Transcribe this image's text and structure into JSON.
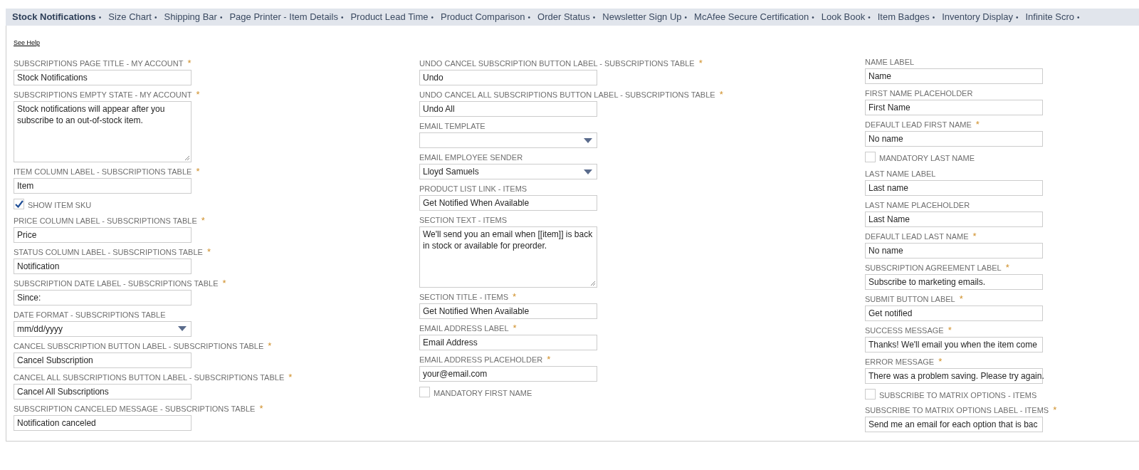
{
  "tabs": [
    {
      "label": "Stock Notifications",
      "selected": true
    },
    {
      "label": "Size Chart",
      "selected": false
    },
    {
      "label": "Shipping Bar",
      "selected": false
    },
    {
      "label": "Page Printer - Item Details",
      "selected": false
    },
    {
      "label": "Product Lead Time",
      "selected": false
    },
    {
      "label": "Product Comparison",
      "selected": false
    },
    {
      "label": "Order Status",
      "selected": false
    },
    {
      "label": "Newsletter Sign Up",
      "selected": false
    },
    {
      "label": "McAfee Secure Certification",
      "selected": false
    },
    {
      "label": "Look Book",
      "selected": false
    },
    {
      "label": "Item Badges",
      "selected": false
    },
    {
      "label": "Inventory Display",
      "selected": false
    },
    {
      "label": "Infinite Scro",
      "selected": false
    }
  ],
  "tab_separator": "•",
  "help_link": "See Help",
  "columns": [
    [
      {
        "kind": "text",
        "label": "SUBSCRIPTIONS PAGE TITLE - MY ACCOUNT",
        "required": true,
        "value": "Stock Notifications"
      },
      {
        "kind": "textarea",
        "label": "SUBSCRIPTIONS EMPTY STATE - MY ACCOUNT",
        "required": true,
        "value": "Stock notifications will appear after you subscribe to an out-of-stock item."
      },
      {
        "kind": "text",
        "label": "ITEM COLUMN LABEL - SUBSCRIPTIONS TABLE",
        "required": true,
        "value": "Item"
      },
      {
        "kind": "checkbox",
        "label": "SHOW ITEM SKU",
        "checked": true
      },
      {
        "kind": "text",
        "label": "PRICE COLUMN LABEL - SUBSCRIPTIONS TABLE",
        "required": true,
        "value": "Price"
      },
      {
        "kind": "text",
        "label": "STATUS COLUMN LABEL - SUBSCRIPTIONS TABLE",
        "required": true,
        "value": "Notification"
      },
      {
        "kind": "text",
        "label": "SUBSCRIPTION DATE LABEL - SUBSCRIPTIONS TABLE",
        "required": true,
        "value": "Since:"
      },
      {
        "kind": "select",
        "label": "DATE FORMAT - SUBSCRIPTIONS TABLE",
        "required": false,
        "value": "mm/dd/yyyy"
      },
      {
        "kind": "text",
        "label": "CANCEL SUBSCRIPTION BUTTON LABEL - SUBSCRIPTIONS TABLE",
        "required": true,
        "value": "Cancel Subscription"
      },
      {
        "kind": "text",
        "label": "CANCEL ALL SUBSCRIPTIONS BUTTON LABEL - SUBSCRIPTIONS TABLE",
        "required": true,
        "value": "Cancel All Subscriptions"
      },
      {
        "kind": "text",
        "label": "SUBSCRIPTION CANCELED MESSAGE - SUBSCRIPTIONS TABLE",
        "required": true,
        "value": "Notification canceled"
      }
    ],
    [
      {
        "kind": "text",
        "label": "UNDO CANCEL SUBSCRIPTION BUTTON LABEL - SUBSCRIPTIONS TABLE",
        "required": true,
        "value": "Undo"
      },
      {
        "kind": "text",
        "label": "UNDO CANCEL ALL SUBSCRIPTIONS BUTTON LABEL - SUBSCRIPTIONS TABLE",
        "required": true,
        "value": "Undo All"
      },
      {
        "kind": "select",
        "label": "EMAIL TEMPLATE",
        "required": false
      },
      {
        "kind": "select",
        "label": "EMAIL EMPLOYEE SENDER",
        "required": false,
        "value": "Lloyd Samuels"
      },
      {
        "kind": "text",
        "label": "PRODUCT LIST LINK - ITEMS",
        "required": false,
        "value": "Get Notified When Available"
      },
      {
        "kind": "textarea",
        "label": "SECTION TEXT - ITEMS",
        "required": false,
        "value": "We'll send you an email when [[item]] is back in stock or available for preorder."
      },
      {
        "kind": "text",
        "label": "SECTION TITLE - ITEMS",
        "required": true,
        "value": "Get Notified When Available"
      },
      {
        "kind": "text",
        "label": "EMAIL ADDRESS LABEL",
        "required": true,
        "value": "Email Address"
      },
      {
        "kind": "text",
        "label": "EMAIL ADDRESS PLACEHOLDER",
        "required": true,
        "value": "your@email.com"
      },
      {
        "kind": "checkbox",
        "label": "MANDATORY FIRST NAME",
        "checked": false
      }
    ],
    [
      {
        "kind": "text",
        "label": "NAME LABEL",
        "required": false,
        "value": "Name"
      },
      {
        "kind": "text",
        "label": "FIRST NAME PLACEHOLDER",
        "required": false,
        "value": "First Name"
      },
      {
        "kind": "text",
        "label": "DEFAULT LEAD FIRST NAME",
        "required": true,
        "value": "No name"
      },
      {
        "kind": "checkbox",
        "label": "MANDATORY LAST NAME",
        "checked": false
      },
      {
        "kind": "text",
        "label": "LAST NAME LABEL",
        "required": false,
        "value": "Last name"
      },
      {
        "kind": "text",
        "label": "LAST NAME PLACEHOLDER",
        "required": false,
        "value": "Last Name"
      },
      {
        "kind": "text",
        "label": "DEFAULT LEAD LAST NAME",
        "required": true,
        "value": "No name"
      },
      {
        "kind": "text",
        "label": "SUBSCRIPTION AGREEMENT LABEL",
        "required": true,
        "value": "Subscribe to marketing emails."
      },
      {
        "kind": "text",
        "label": "SUBMIT BUTTON LABEL",
        "required": true,
        "value": "Get notified"
      },
      {
        "kind": "text",
        "label": "SUCCESS MESSAGE",
        "required": true,
        "value": "Thanks! We'll email you when the item come"
      },
      {
        "kind": "text",
        "label": "ERROR MESSAGE",
        "required": true,
        "value": "There was a problem saving. Please try again."
      },
      {
        "kind": "checkbox",
        "label": "SUBSCRIBE TO MATRIX OPTIONS - ITEMS",
        "checked": false
      },
      {
        "kind": "text",
        "label": "SUBSCRIBE TO MATRIX OPTIONS LABEL - ITEMS",
        "required": true,
        "value": "Send me an email for each option that is bac"
      }
    ]
  ],
  "required_mark": "*"
}
